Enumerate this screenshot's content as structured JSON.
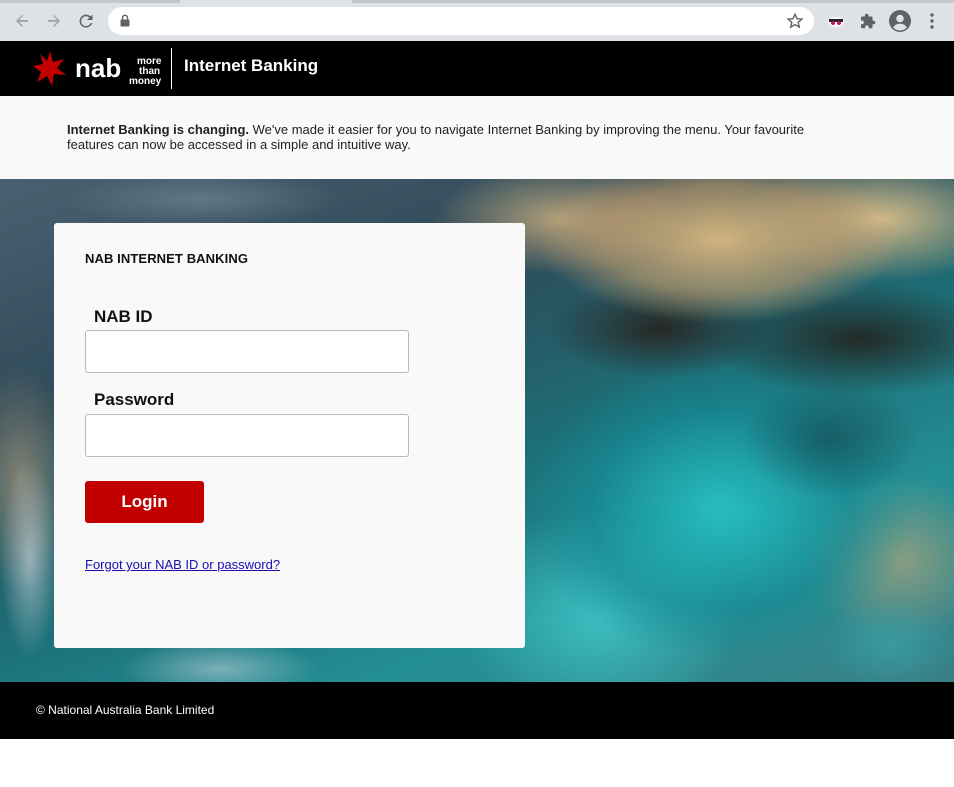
{
  "browser": {
    "url": "",
    "icons": {
      "back": "back-arrow-icon",
      "forward": "forward-arrow-icon",
      "reload": "reload-icon",
      "lock": "lock-icon",
      "bookmark": "star-icon",
      "extension_1": "incognito-extension-icon",
      "extensions": "puzzle-icon",
      "profile": "profile-icon",
      "menu": "kebab-menu-icon"
    }
  },
  "header": {
    "logo_text": "nab",
    "tagline": [
      "more",
      "than",
      "money"
    ],
    "title": "Internet Banking",
    "brand_color": "#c20000"
  },
  "notice": {
    "bold": "Internet Banking is changing.",
    "text": " We've made it easier for you to navigate Internet Banking by improving the menu. Your favourite features can now be accessed in a simple and intuitive way."
  },
  "login": {
    "title": "NAB INTERNET BANKING",
    "nab_id_label": "NAB ID",
    "nab_id_value": "",
    "password_label": "Password",
    "password_value": "",
    "button_label": "Login",
    "forgot_link": "Forgot your NAB ID or password?"
  },
  "footer": {
    "copyright": "© National Australia Bank Limited"
  }
}
